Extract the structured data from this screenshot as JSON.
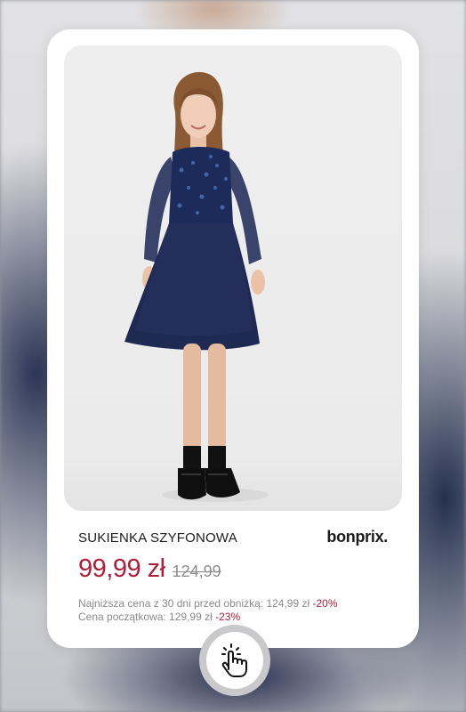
{
  "product": {
    "title": "SUKIENKA SZYFONOWA",
    "brand": "bonprix.",
    "price_current": "99,99 zł",
    "price_old": "124,99",
    "lowest_price_text": "Najniższa cena z 30 dni  przed obniżką: 124,99 zł",
    "lowest_price_discount": "-20%",
    "initial_price_text": "Cena początkowa: 129,99 zł",
    "initial_price_discount": "-23%",
    "image_icon": "dress-photo"
  },
  "cta": {
    "icon": "tap-hand-icon"
  },
  "colors": {
    "price": "#b01e3a",
    "discount": "#b01e3a",
    "muted_text": "#8a8a8a",
    "card": "#ffffff"
  }
}
